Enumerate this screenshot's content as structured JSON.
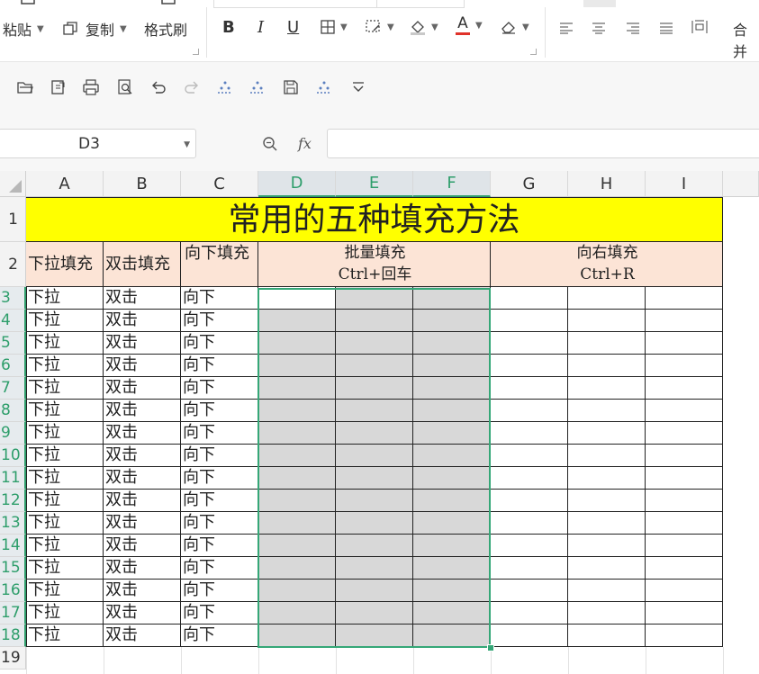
{
  "ribbon": {
    "paste_label": "粘贴",
    "copy_label": "复制",
    "format_painter_label": "格式刷",
    "bold_label": "B",
    "italic_label": "I",
    "underline_label": "U",
    "font_color_label": "A",
    "merge_label": "合并",
    "accent_red": "#e0322a"
  },
  "formula_bar": {
    "name_box_value": "D3",
    "fx_label": "fx",
    "formula_value": ""
  },
  "columns": [
    "A",
    "B",
    "C",
    "D",
    "E",
    "F",
    "G",
    "H",
    "I"
  ],
  "rows": [
    "1",
    "2",
    "3",
    "4",
    "5",
    "6",
    "7",
    "8",
    "9",
    "10",
    "11",
    "12",
    "13",
    "14",
    "15",
    "16",
    "17",
    "18",
    "19"
  ],
  "sheet": {
    "title": "常用的五种填充方法",
    "headers": {
      "a2": "下拉填充",
      "b2": "双击填充",
      "c2": "向下填充",
      "def2_line1": "批量填充",
      "def2_line2": "Ctrl+回车",
      "ghi2_line1": "向右填充",
      "ghi2_line2": "Ctrl+R"
    },
    "col_a_value": "下拉",
    "col_b_value": "双击",
    "col_c_value": "向下"
  },
  "colors": {
    "title_bg": "#ffff00",
    "header_bg": "#fce4d6",
    "selection": "#35a777",
    "selected_fill": "#d8d8d8"
  }
}
